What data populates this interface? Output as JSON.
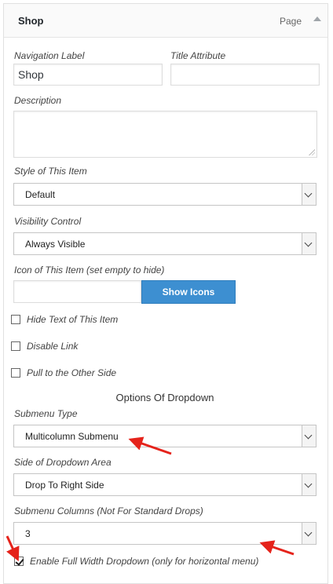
{
  "header": {
    "title": "Shop",
    "item_type": "Page"
  },
  "fields": {
    "navigation_label": {
      "label": "Navigation Label",
      "value": "Shop"
    },
    "title_attribute": {
      "label": "Title Attribute",
      "value": ""
    },
    "description": {
      "label": "Description",
      "value": ""
    },
    "style": {
      "label": "Style of This Item",
      "value": "Default"
    },
    "visibility": {
      "label": "Visibility Control",
      "value": "Always Visible"
    },
    "icon": {
      "label": "Icon of This Item (set empty to hide)",
      "value": "",
      "button": "Show Icons"
    }
  },
  "checkboxes": [
    {
      "label": "Hide Text of This Item",
      "checked": false
    },
    {
      "label": "Disable Link",
      "checked": false
    },
    {
      "label": "Pull to the Other Side",
      "checked": false
    }
  ],
  "dropdown_section": {
    "heading": "Options Of Dropdown",
    "submenu_type": {
      "label": "Submenu Type",
      "value": "Multicolumn Submenu"
    },
    "side": {
      "label": "Side of Dropdown Area",
      "value": "Drop To Right Side"
    },
    "columns": {
      "label": "Submenu Columns (Not For Standard Drops)",
      "value": "3"
    },
    "full_width": {
      "label": "Enable Full Width Dropdown (only for horizontal menu)",
      "checked": true
    }
  },
  "colors": {
    "accent_button": "#3d8fd1",
    "annotation_arrow": "#e5231b"
  }
}
